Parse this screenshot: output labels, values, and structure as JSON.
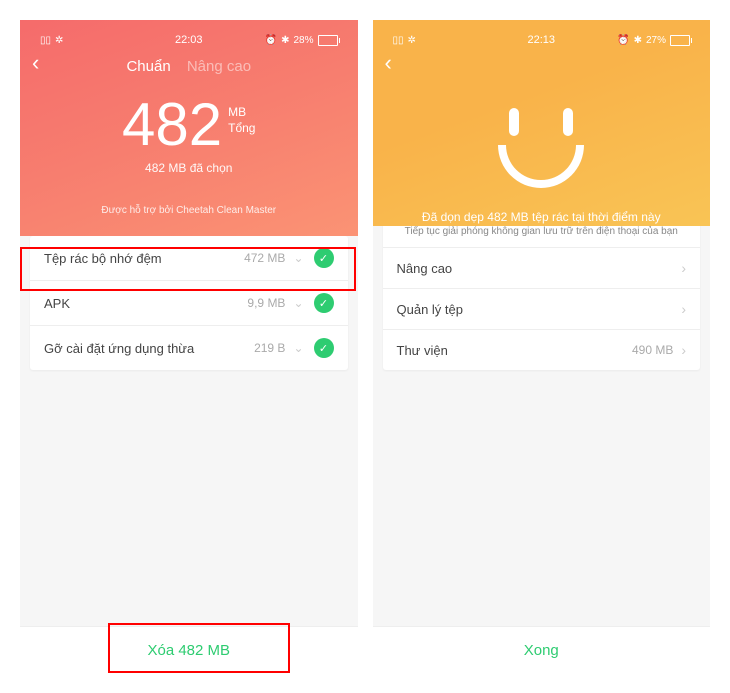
{
  "left": {
    "status": {
      "time": "22:03",
      "battery_pct": "28%",
      "battery_fill_pct": 28
    },
    "tabs": {
      "active": "Chuẩn",
      "inactive": "Nâng cao"
    },
    "big": {
      "value": "482",
      "unit": "MB",
      "total_label": "Tổng"
    },
    "selected": "482 MB đã chọn",
    "sponsor": "Được hỗ trợ bởi Cheetah Clean Master",
    "rows": [
      {
        "label": "Tệp rác bộ nhớ đệm",
        "size": "472 MB"
      },
      {
        "label": "APK",
        "size": "9,9 MB"
      },
      {
        "label": "Gỡ cài đặt ứng dụng thừa",
        "size": "219 B"
      }
    ],
    "bottom": "Xóa 482 MB"
  },
  "right": {
    "status": {
      "time": "22:13",
      "battery_pct": "27%",
      "battery_fill_pct": 27
    },
    "cleaned": "Đã dọn dẹp 482 MB tệp rác tại thời điểm này",
    "hint": "Tiếp tục giải phóng không gian lưu trữ trên điện thoại của bạn",
    "rows": [
      {
        "label": "Nâng cao",
        "size": ""
      },
      {
        "label": "Quản lý tệp",
        "size": ""
      },
      {
        "label": "Thư viện",
        "size": "490 MB"
      }
    ],
    "bottom": "Xong"
  }
}
